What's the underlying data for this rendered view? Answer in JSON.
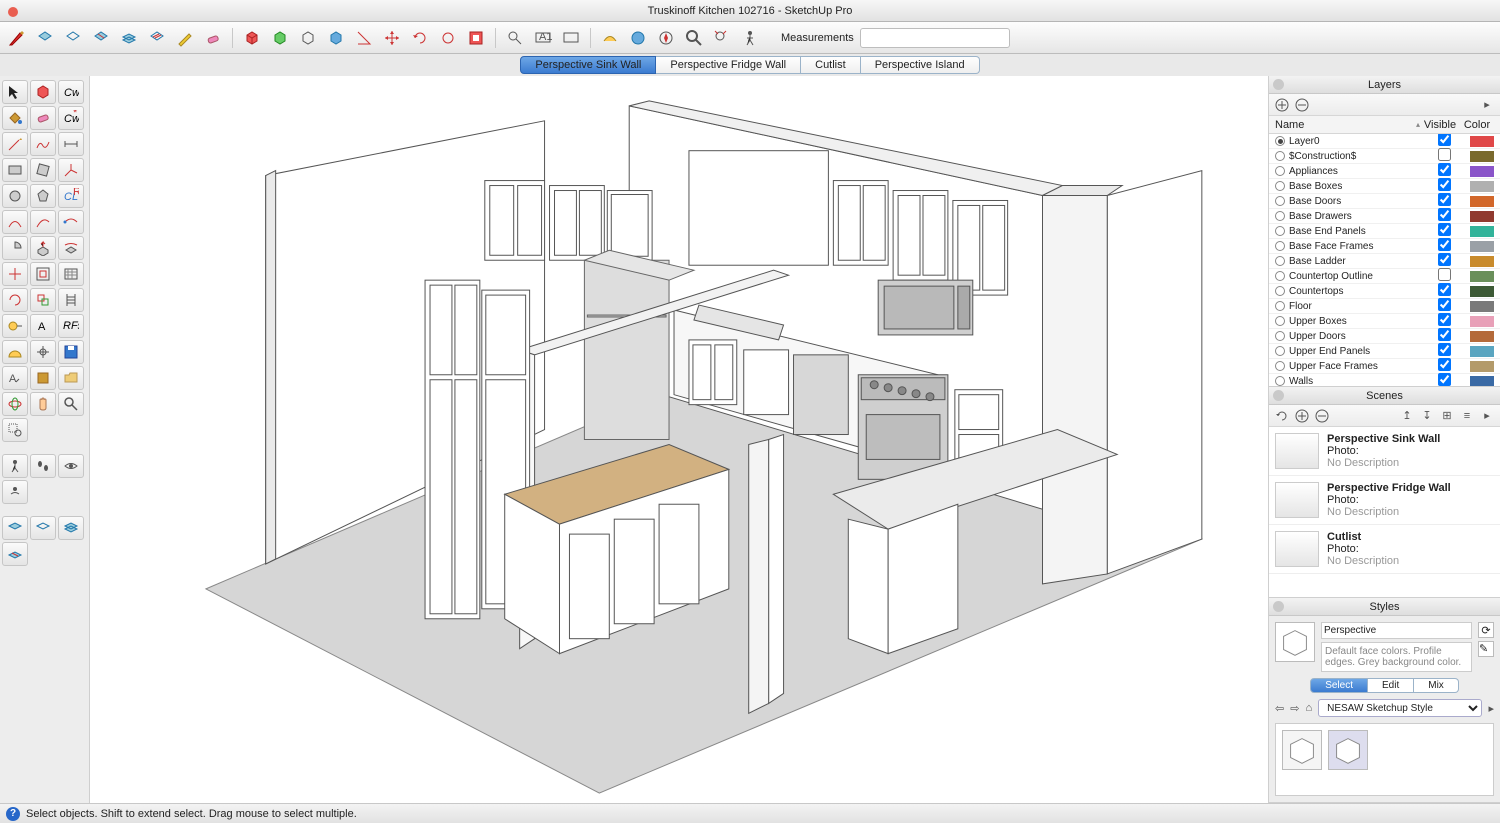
{
  "window": {
    "title": "Truskinoff Kitchen 102716 - SketchUp Pro"
  },
  "toolbar": {
    "measurements_label": "Measurements",
    "measurements_value": ""
  },
  "tabs": [
    {
      "label": "Perspective Sink Wall",
      "active": true
    },
    {
      "label": "Perspective Fridge Wall",
      "active": false
    },
    {
      "label": "Cutlist",
      "active": false
    },
    {
      "label": "Perspective Island",
      "active": false
    }
  ],
  "panels": {
    "layers": {
      "title": "Layers",
      "columns": {
        "name": "Name",
        "visible": "Visible",
        "color": "Color"
      },
      "rows": [
        {
          "name": "Layer0",
          "active": true,
          "visible": true,
          "color": "#e04848"
        },
        {
          "name": "$Construction$",
          "active": false,
          "visible": false,
          "color": "#7a6a2d"
        },
        {
          "name": "Appliances",
          "active": false,
          "visible": true,
          "color": "#8a55c9"
        },
        {
          "name": "Base Boxes",
          "active": false,
          "visible": true,
          "color": "#b0b0b0"
        },
        {
          "name": "Base Doors",
          "active": false,
          "visible": true,
          "color": "#d2672a"
        },
        {
          "name": "Base Drawers",
          "active": false,
          "visible": true,
          "color": "#903a2f"
        },
        {
          "name": "Base End Panels",
          "active": false,
          "visible": true,
          "color": "#32b39a"
        },
        {
          "name": "Base Face Frames",
          "active": false,
          "visible": true,
          "color": "#9aa0a6"
        },
        {
          "name": "Base Ladder",
          "active": false,
          "visible": true,
          "color": "#c98b2c"
        },
        {
          "name": "Countertop Outline",
          "active": false,
          "visible": false,
          "color": "#6a8f5a"
        },
        {
          "name": "Countertops",
          "active": false,
          "visible": true,
          "color": "#3d5a36"
        },
        {
          "name": "Floor",
          "active": false,
          "visible": true,
          "color": "#7a7a7a"
        },
        {
          "name": "Upper Boxes",
          "active": false,
          "visible": true,
          "color": "#e8a0b8"
        },
        {
          "name": "Upper Doors",
          "active": false,
          "visible": true,
          "color": "#b46a3a"
        },
        {
          "name": "Upper End Panels",
          "active": false,
          "visible": true,
          "color": "#5aa5c0"
        },
        {
          "name": "Upper Face Frames",
          "active": false,
          "visible": true,
          "color": "#b39a6a"
        },
        {
          "name": "Walls",
          "active": false,
          "visible": true,
          "color": "#3a6aa5"
        }
      ]
    },
    "scenes": {
      "title": "Scenes",
      "items": [
        {
          "title": "Perspective Sink Wall",
          "photo_label": "Photo:",
          "desc": "No Description"
        },
        {
          "title": "Perspective Fridge Wall",
          "photo_label": "Photo:",
          "desc": "No Description"
        },
        {
          "title": "Cutlist",
          "photo_label": "Photo:",
          "desc": "No Description"
        }
      ]
    },
    "styles": {
      "title": "Styles",
      "name": "Perspective",
      "desc": "Default face colors. Profile edges. Grey background color.",
      "tabs": [
        "Select",
        "Edit",
        "Mix"
      ],
      "active_tab": "Select",
      "selector": "NESAW Sketchup Style"
    }
  },
  "status": {
    "text": "Select objects. Shift to extend select. Drag mouse to select multiple."
  }
}
